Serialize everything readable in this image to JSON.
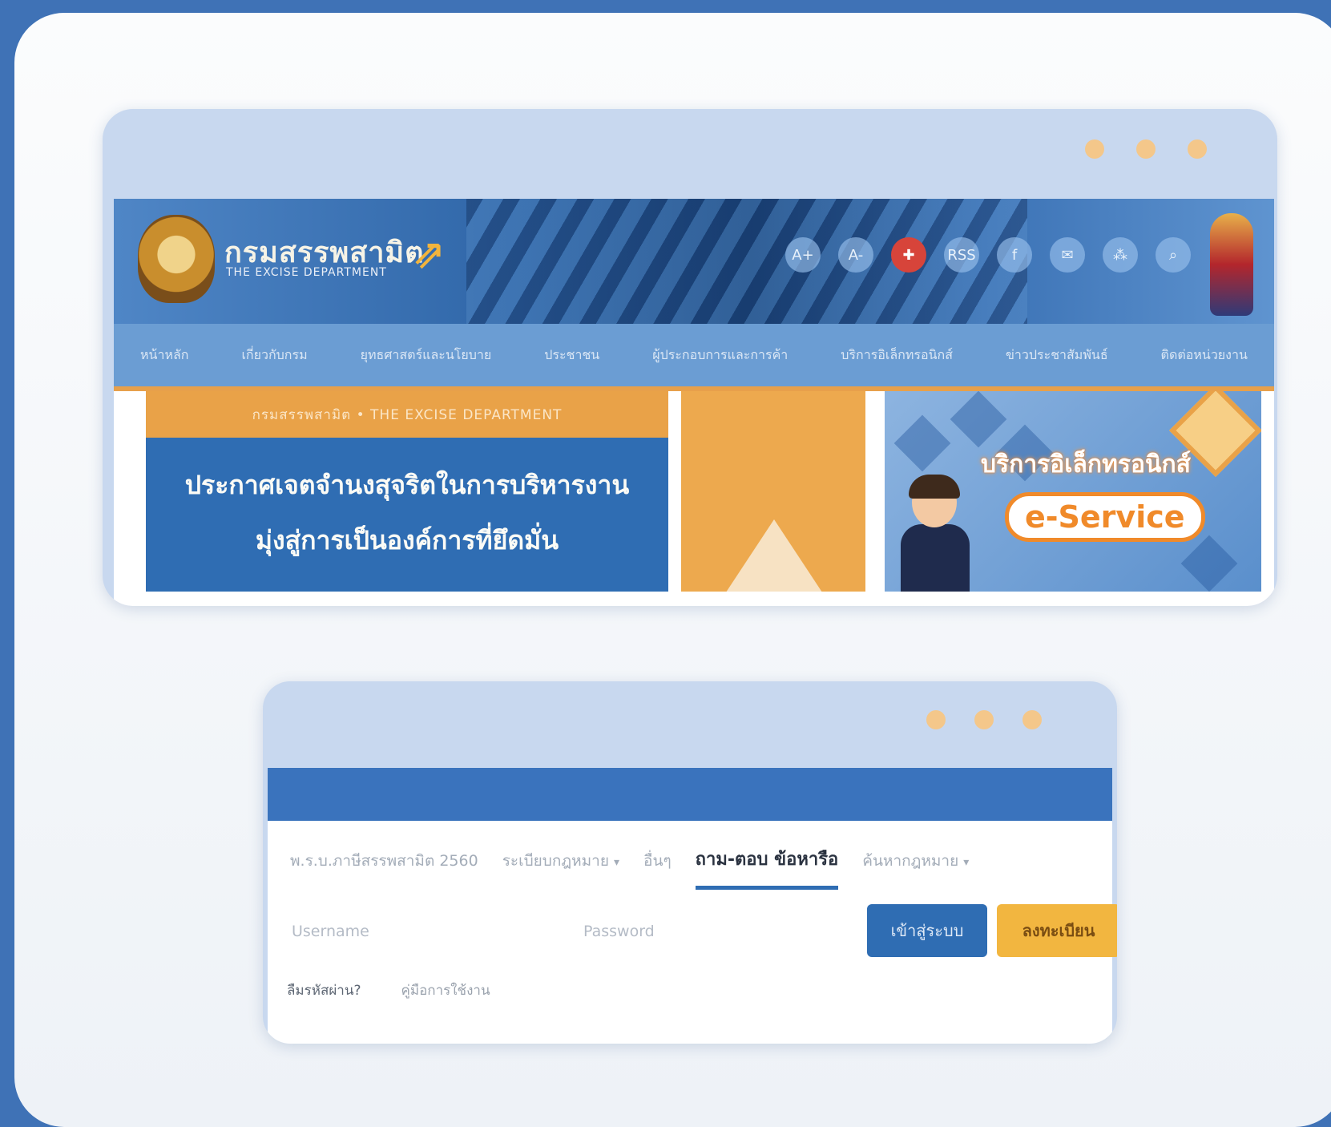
{
  "site_window": {
    "logo": {
      "thai_name": "กรมสรรพสามิต",
      "english_name": "THE EXCISE DEPARTMENT"
    },
    "header_icons": [
      {
        "name": "font-size-increase-icon",
        "glyph": "A+"
      },
      {
        "name": "font-size-decrease-icon",
        "glyph": "A-"
      },
      {
        "name": "uk-flag-icon",
        "glyph": "✚"
      },
      {
        "name": "rss-icon",
        "glyph": "RSS"
      },
      {
        "name": "facebook-icon",
        "glyph": "f"
      },
      {
        "name": "mail-icon",
        "glyph": "✉"
      },
      {
        "name": "sitemap-icon",
        "glyph": "⁂"
      },
      {
        "name": "search-icon",
        "glyph": "⌕"
      }
    ],
    "nav": [
      "หน้าหลัก",
      "เกี่ยวกับกรม",
      "ยุทธศาสตร์และนโยบาย",
      "ประชาชน",
      "ผู้ประกอบการและการค้า",
      "บริการอิเล็กทรอนิกส์",
      "ข่าวประชาสัมพันธ์",
      "ติดต่อหน่วยงาน"
    ],
    "banner": {
      "strip": "กรมสรรพสามิต • THE EXCISE DEPARTMENT",
      "line1": "ประกาศเจตจำนงสุจริตในการบริหารงาน",
      "line2": "มุ่งสู่การเป็นองค์การที่ยึดมั่น"
    },
    "eservice": {
      "title": "บริการอิเล็กทรอนิกส์",
      "subtitle": "e-Service"
    }
  },
  "login_window": {
    "tabs": [
      {
        "label": "พ.ร.บ.ภาษีสรรพสามิต 2560",
        "active": false,
        "dropdown": false
      },
      {
        "label": "ระเบียบกฎหมาย",
        "active": false,
        "dropdown": true
      },
      {
        "label": "อื่นๆ",
        "active": false,
        "dropdown": false
      },
      {
        "label": "ถาม-ตอบ ข้อหารือ",
        "active": true,
        "dropdown": false
      },
      {
        "label": "ค้นหากฎหมาย",
        "active": false,
        "dropdown": true
      }
    ],
    "username_placeholder": "Username",
    "password_placeholder": "Password",
    "login_button": "เข้าสู่ระบบ",
    "register_button": "ลงทะเบียน",
    "forgot_password": "ลืมรหัสผ่าน?",
    "user_manual": "คู่มือการใช้งาน"
  },
  "colors": {
    "frame": "#3f72b6",
    "accent_blue": "#2f6db3",
    "accent_orange": "#e9a248",
    "register_yellow": "#f2b640"
  }
}
